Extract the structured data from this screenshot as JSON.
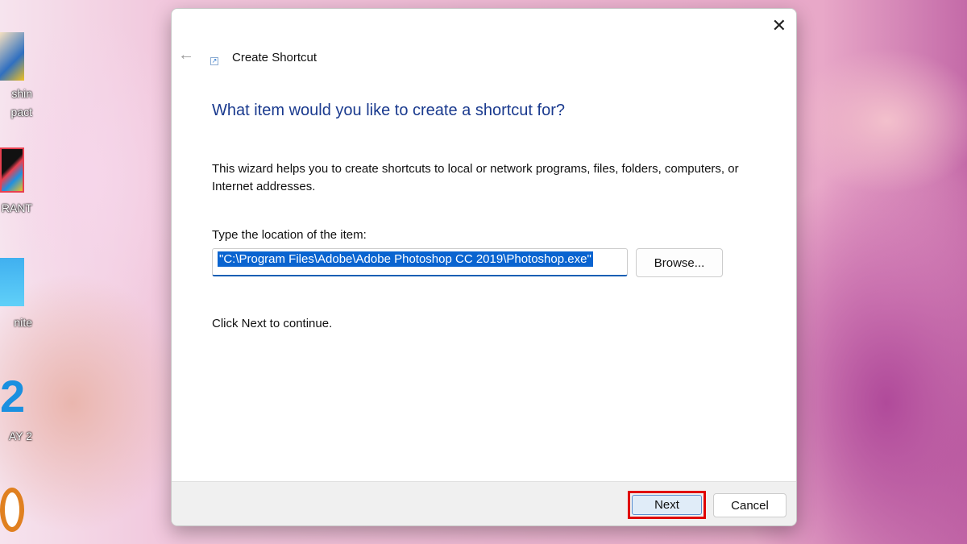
{
  "desktop": {
    "icons": [
      {
        "label": "shin"
      },
      {
        "label": "pact"
      },
      {
        "label": "RANT"
      },
      {
        "label": "nite"
      },
      {
        "label": "AY 2"
      }
    ]
  },
  "dialog": {
    "title": "Create Shortcut",
    "close": "✕",
    "back": "←",
    "heading": "What item would you like to create a shortcut for?",
    "description": "This wizard helps you to create shortcuts to local or network programs, files, folders, computers, or Internet addresses.",
    "location_label": "Type the location of the item:",
    "location_value": "\"C:\\Program Files\\Adobe\\Adobe Photoshop CC 2019\\Photoshop.exe\"",
    "browse_label": "Browse...",
    "continue_text": "Click Next to continue.",
    "next_label": "Next",
    "cancel_label": "Cancel"
  },
  "colors": {
    "heading": "#1a3a8e",
    "highlight": "#0a64d0",
    "annotation": "#e00000"
  }
}
